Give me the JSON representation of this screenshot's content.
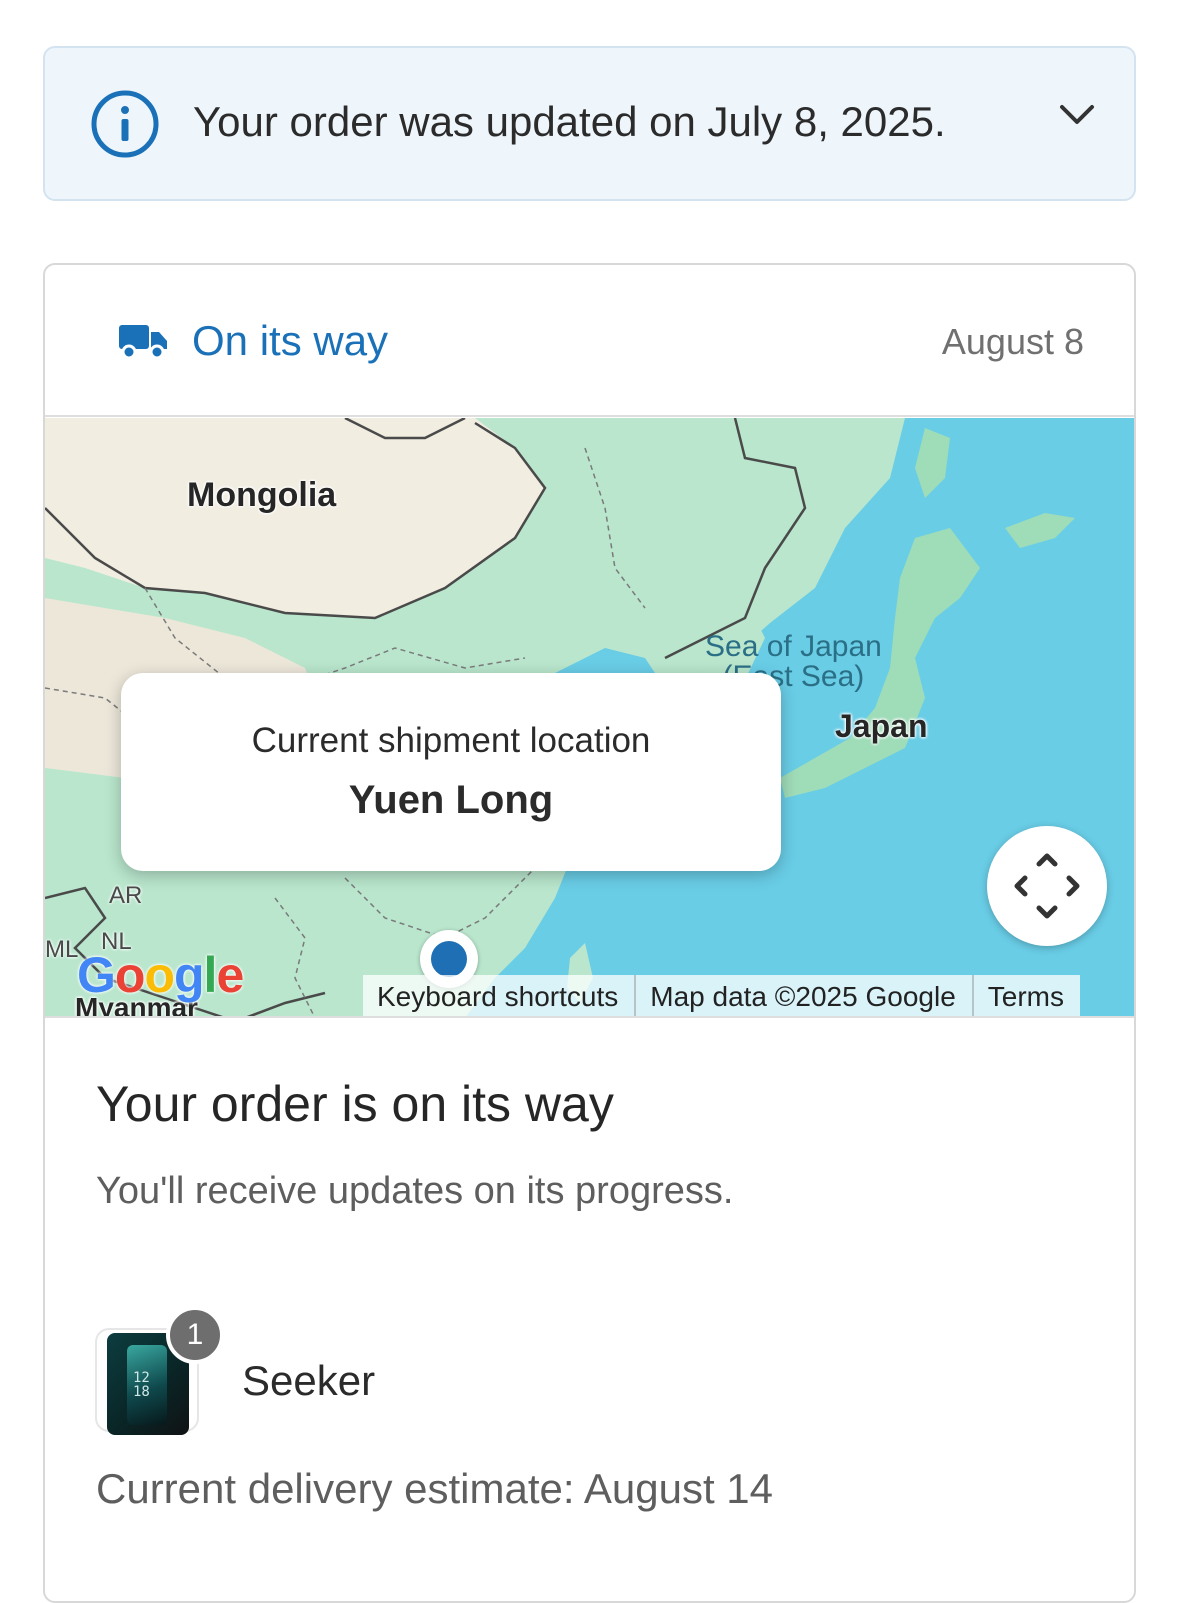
{
  "banner": {
    "message": "Your order was updated on July 8, 2025.",
    "icon": "info-icon",
    "toggle_icon": "chevron-down-icon"
  },
  "shipment": {
    "status": "On its way",
    "status_icon": "truck-icon",
    "date": "August 8",
    "accent_color": "#1b71b8"
  },
  "map": {
    "labels": {
      "mongolia": "Mongolia",
      "japan": "Japan",
      "sea_line1": "Sea of Japan",
      "sea_line2": "(East Sea)",
      "ar": "AR",
      "nl": "NL",
      "ml": "ML",
      "myanmar": "Myanmar"
    },
    "popup": {
      "title": "Current shipment location",
      "location": "Yuen Long"
    },
    "logo": "Google",
    "attribution": {
      "keyboard": "Keyboard shortcuts",
      "data": "Map data ©2025 Google",
      "terms": "Terms"
    }
  },
  "order": {
    "title": "Your order is on its way",
    "subtitle": "You'll receive updates on its progress.",
    "item": {
      "name": "Seeker",
      "quantity": "1",
      "thumb_clock": "12\n18"
    },
    "estimate": "Current delivery estimate: August 14"
  }
}
